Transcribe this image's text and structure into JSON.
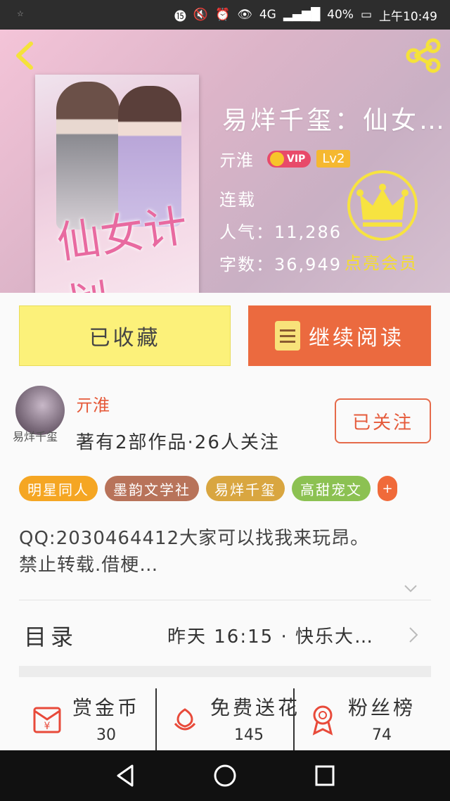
{
  "status_bar": {
    "battery": "40%",
    "time": "上午10:49",
    "network": "4G"
  },
  "book": {
    "title": "易烊千玺：仙女…",
    "author": "亓淮",
    "vip_label": "VIP",
    "level": "Lv2",
    "status": "连载",
    "popularity_label": "人气：",
    "popularity": "11,286",
    "word_count_label": "字数：",
    "word_count": "36,949",
    "cover_title_art": "仙女计划",
    "vip_promo": "点亮会员"
  },
  "actions": {
    "collected_label": "已收藏",
    "read_label": "继续阅读"
  },
  "author_card": {
    "name": "亓淮",
    "avatar_caption": "易烊千玺",
    "stats": "著有2部作品·26人关注",
    "follow_label": "已关注"
  },
  "tags": [
    {
      "label": "明星同人",
      "color": "#f5a623"
    },
    {
      "label": "墨韵文学社",
      "color": "#b8735a"
    },
    {
      "label": "易烊千玺",
      "color": "#d9a640"
    },
    {
      "label": "高甜宠文",
      "color": "#8cc152"
    }
  ],
  "tag_more": "+",
  "description": {
    "line1": "QQ:2030464412大家可以找我来玩昂。",
    "line2": "禁止转载.借梗…"
  },
  "toc": {
    "label": "目录",
    "latest": "昨天 16:15 · 快乐大…"
  },
  "stats": [
    {
      "label": "赏金币",
      "value": "30",
      "icon": "coin-envelope-icon"
    },
    {
      "label": "免费送花",
      "value": "145",
      "icon": "flower-icon"
    },
    {
      "label": "粉丝榜",
      "value": "74",
      "icon": "medal-icon"
    }
  ],
  "colors": {
    "accent_orange": "#eb6a3f",
    "collected_yellow": "#fcf17a",
    "author_red": "#e55a3a"
  }
}
